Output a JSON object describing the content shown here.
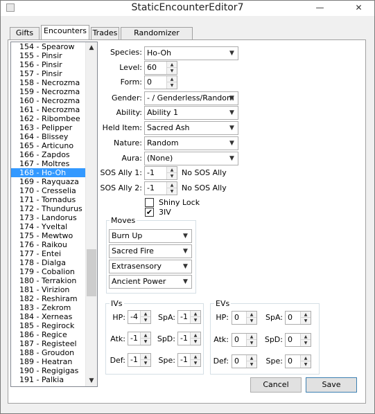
{
  "window": {
    "title": "StaticEncounterEditor7"
  },
  "tabs": [
    {
      "label": "Gifts"
    },
    {
      "label": "Encounters"
    },
    {
      "label": "Trades"
    },
    {
      "label": "Randomizer Options"
    }
  ],
  "encounter_list": {
    "selected_index": 14,
    "items": [
      "154 - Spearow",
      "155 - Pinsir",
      "156 - Pinsir",
      "157 - Pinsir",
      "158 - Necrozma",
      "159 - Necrozma",
      "160 - Necrozma",
      "161 - Necrozma",
      "162 - Ribombee",
      "163 - Pelipper",
      "164 - Blissey",
      "165 - Articuno",
      "166 - Zapdos",
      "167 - Moltres",
      "168 - Ho-Oh",
      "169 - Rayquaza",
      "170 - Cresselia",
      "171 - Tornadus",
      "172 - Thundurus",
      "173 - Landorus",
      "174 - Yveltal",
      "175 - Mewtwo",
      "176 - Raikou",
      "177 - Entei",
      "178 - Dialga",
      "179 - Cobalion",
      "180 - Terrakion",
      "181 - Virizion",
      "182 - Reshiram",
      "183 - Zekrom",
      "184 - Xerneas",
      "185 - Regirock",
      "186 - Regice",
      "187 - Registeel",
      "188 - Groudon",
      "189 - Heatran",
      "190 - Regigigas",
      "191 - Palkia"
    ]
  },
  "form": {
    "species": {
      "label": "Species:",
      "value": "Ho-Oh"
    },
    "level": {
      "label": "Level:",
      "value": "60"
    },
    "form": {
      "label": "Form:",
      "value": "0"
    },
    "gender": {
      "label": "Gender:",
      "value": "- / Genderless/Random"
    },
    "ability": {
      "label": "Ability:",
      "value": "Ability 1"
    },
    "held_item": {
      "label": "Held Item:",
      "value": "Sacred Ash"
    },
    "nature": {
      "label": "Nature:",
      "value": "Random"
    },
    "aura": {
      "label": "Aura:",
      "value": "(None)"
    },
    "sos_ally_1": {
      "label": "SOS Ally 1:",
      "value": "-1",
      "status": "No SOS Ally"
    },
    "sos_ally_2": {
      "label": "SOS Ally 2:",
      "value": "-1",
      "status": "No SOS Ally"
    },
    "shiny_lock": {
      "label": "Shiny Lock",
      "checked": false
    },
    "three_iv": {
      "label": "3IV",
      "checked": true
    }
  },
  "moves": {
    "title": "Moves",
    "values": [
      "Burn Up",
      "Sacred Fire",
      "Extrasensory",
      "Ancient Power"
    ]
  },
  "ivs": {
    "title": "IVs",
    "hp": {
      "label": "HP:",
      "value": "-4"
    },
    "atk": {
      "label": "Atk:",
      "value": "-1"
    },
    "def": {
      "label": "Def:",
      "value": "-1"
    },
    "spa": {
      "label": "SpA:",
      "value": "-1"
    },
    "spd": {
      "label": "SpD:",
      "value": "-1"
    },
    "spe": {
      "label": "Spe:",
      "value": "-1"
    }
  },
  "evs": {
    "title": "EVs",
    "hp": {
      "label": "HP:",
      "value": "0"
    },
    "atk": {
      "label": "Atk:",
      "value": "0"
    },
    "def": {
      "label": "Def:",
      "value": "0"
    },
    "spa": {
      "label": "SpA:",
      "value": "0"
    },
    "spd": {
      "label": "SpD:",
      "value": "0"
    },
    "spe": {
      "label": "Spe:",
      "value": "0"
    }
  },
  "buttons": {
    "cancel": "Cancel",
    "save": "Save"
  },
  "icons": {
    "app": "app-icon",
    "minimize": "minimize-icon",
    "close": "close-icon",
    "scroll_up": "arrow-up-icon",
    "scroll_down": "arrow-down-icon",
    "dropdown": "chevron-down-icon",
    "spin_up": "spin-up-icon",
    "spin_down": "spin-down-icon",
    "check": "checkmark-icon"
  },
  "colors": {
    "selection": "#3399ff",
    "window_bg": "#f0f0f0",
    "default_button_border": "#3c7fb1"
  }
}
